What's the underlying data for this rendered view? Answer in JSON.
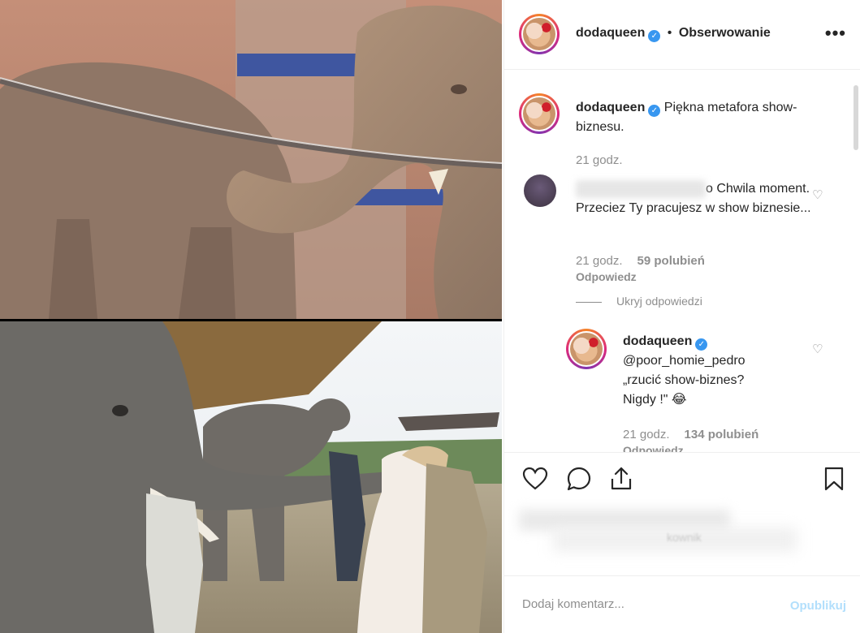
{
  "post": {
    "author": "dodaqueen",
    "follow_state": "Obserwowanie",
    "more_glyph": "•••"
  },
  "caption": {
    "author": "dodaqueen",
    "text": "Piękna metafora show-biznesu.",
    "time": "21 godz."
  },
  "comment": {
    "visible_suffix": "o",
    "text": "Chwila moment. Przeciez Ty pracujesz w show biznesie...",
    "time": "21 godz.",
    "likes": "59 polubień",
    "reply_label": "Odpowiedz",
    "hide_replies": "Ukryj odpowiedzi"
  },
  "reply": {
    "author": "dodaqueen",
    "mention": "@poor_homie_pedro",
    "text_line1": "„rzucić show-biznes?",
    "text_line2": "Nigdy !\" 😂",
    "time": "21 godz.",
    "likes": "134 polubień",
    "reply_label": "Odpowiedz"
  },
  "likes_blurred_fragment": "kownik",
  "add_comment": {
    "placeholder": "Dodaj komentarz...",
    "publish": "Opublikuj"
  },
  "icons": [
    "heart-icon",
    "comment-icon",
    "share-icon",
    "bookmark-icon",
    "verified-icon",
    "more-icon"
  ],
  "colors": {
    "verified": "#3897f0",
    "muted": "#8e8e8e",
    "publish_disabled": "#b2dffc"
  }
}
